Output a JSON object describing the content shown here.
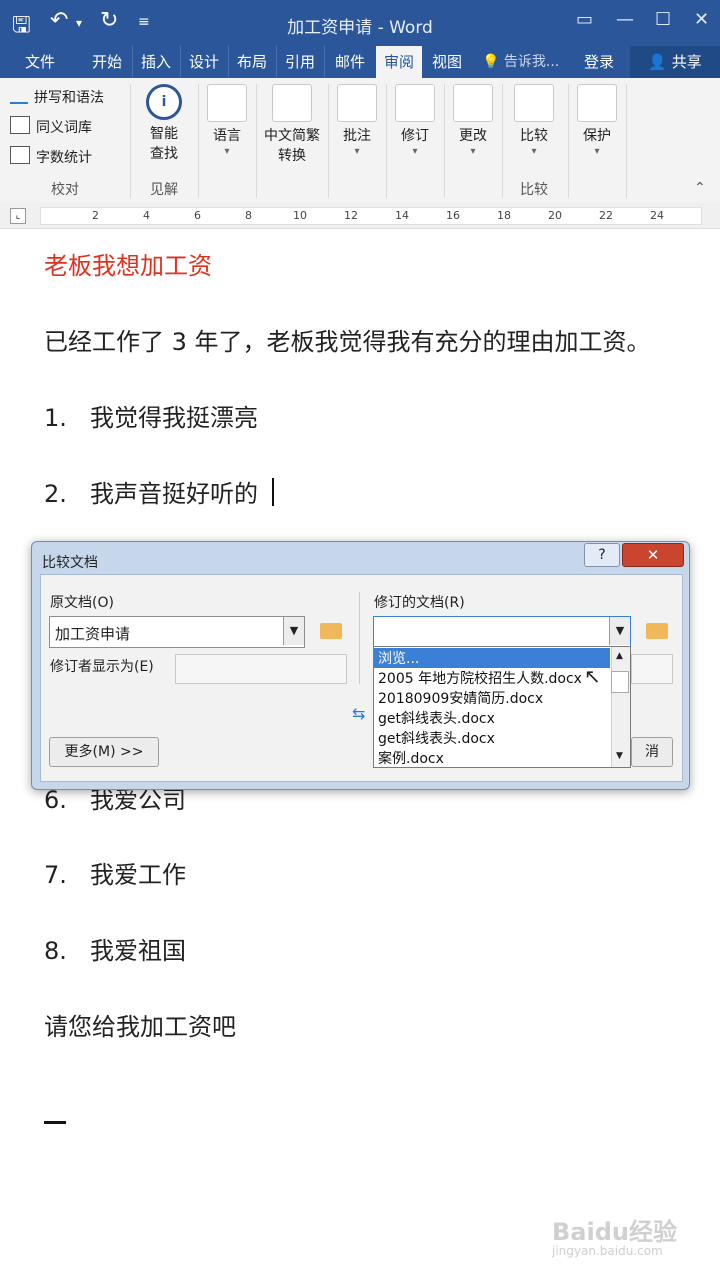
{
  "window": {
    "title": "加工资申请 - Word"
  },
  "tabs": [
    "文件",
    "开始",
    "插入",
    "设计",
    "布局",
    "引用",
    "邮件",
    "审阅",
    "视图"
  ],
  "active_tab": "审阅",
  "tell_me": "告诉我...",
  "login": "登录",
  "share": "共享",
  "ribbon": {
    "proofing": {
      "spell": "拼写和语法",
      "thesaurus": "同义词库",
      "wordcount": "字数统计",
      "label": "校对"
    },
    "insights": {
      "smart_lookup": [
        "智能",
        "查找"
      ],
      "label": "见解"
    },
    "language": "语言",
    "chinese_conv": [
      "中文简繁",
      "转换"
    ],
    "comments": "批注",
    "tracking": "修订",
    "changes": "更改",
    "compare": {
      "button": "比较",
      "label": "比较"
    },
    "protect": "保护"
  },
  "ruler_numbers": [
    "2",
    "4",
    "6",
    "8",
    "10",
    "12",
    "14",
    "16",
    "18",
    "20",
    "22",
    "24"
  ],
  "document": {
    "title": "老板我想加工资",
    "para1": "已经工作了 3 年了，老板我觉得我有充分的理由加工资。",
    "items": [
      {
        "num": "1.",
        "text": "我觉得我挺漂亮"
      },
      {
        "num": "2.",
        "text": "我声音挺好听的"
      },
      {
        "num": "6.",
        "text": "我爱公司"
      },
      {
        "num": "7.",
        "text": "我爱工作"
      },
      {
        "num": "8.",
        "text": "我爱祖国"
      }
    ],
    "closing": "请您给我加工资吧"
  },
  "dialog": {
    "title": "比较文档",
    "help": "?",
    "close": "✕",
    "original_label": "原文档(O)",
    "original_value": "加工资申请",
    "author_label": "修订者显示为(E)",
    "revised_label": "修订的文档(R)",
    "revised_value": "",
    "more_button": "更多(M) >>",
    "cancel_partial": "消",
    "dropdown": [
      "浏览...",
      "2005 年地方院校招生人数.docx",
      "20180909安婧简历.docx",
      "get斜线表头.docx",
      "get斜线表头.docx",
      "案例.docx"
    ]
  },
  "watermark": {
    "brand": "Baidu经验",
    "url": "jingyan.baidu.com"
  }
}
